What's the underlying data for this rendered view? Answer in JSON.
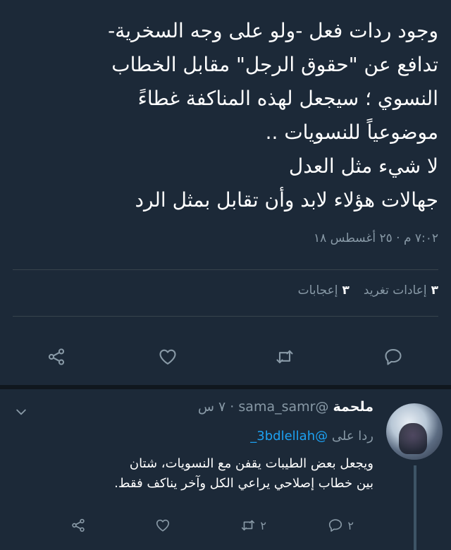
{
  "tweet": {
    "lines": [
      "وجود ردات فعل -ولو على وجه السخرية-",
      "تدافع عن \"حقوق الرجل\" مقابل الخطاب",
      "النسوي ؛ سيجعل لهذه المناكفة غطاءً",
      "موضوعياً للنسويات ..",
      "لا شيء مثل العدل",
      "جهالات هؤلاء لابد وأن تقابل بمثل الرد"
    ],
    "timestamp": "٧:٠٢ م · ٢٥ أغسطس ١٨",
    "retweets_count": "٣",
    "retweets_label": "إعادات تغريد",
    "likes_count": "٣",
    "likes_label": "إعجابات"
  },
  "actions": {
    "reply": "reply-icon",
    "retweet": "retweet-icon",
    "like": "heart-icon",
    "share": "share-icon"
  },
  "reply": {
    "name": "ملحمة",
    "handle": "@sama_samr",
    "time": "· ٧ س",
    "reply_to_label": "ردا على",
    "mention": "@3bdlellah_",
    "lines": [
      "ويجعل بعض الطيبات يقفن مع النسويات، شتان",
      "بين خطاب إصلاحي يراعي الكل وآخر يناكف فقط."
    ],
    "reply_count": "٢",
    "retweet_count": "٢"
  },
  "colors": {
    "background": "#1c2938",
    "muted": "#8899a6",
    "link": "#1da1f2",
    "divider": "#38444d"
  }
}
